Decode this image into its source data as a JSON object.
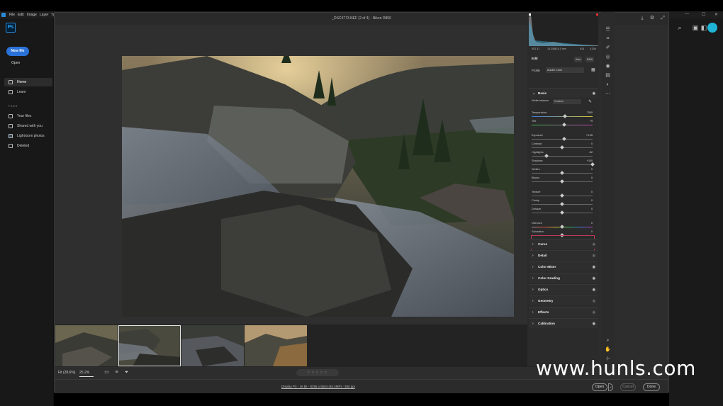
{
  "ps_menubar": {
    "items": [
      "File",
      "Edit",
      "Image",
      "Layer",
      "Ty"
    ]
  },
  "ps_home": {
    "logo": "Ps",
    "new_file": "New file",
    "open": "Open",
    "nav": [
      "Home",
      "Learn"
    ],
    "files_header": "FILES",
    "files": [
      "Your files",
      "Shared with you",
      "Lightroom photos",
      "Deleted"
    ]
  },
  "acr": {
    "title": "_DSC4773.NEF (2 of 4)  -  Nikon D850",
    "meta": {
      "iso": "ISO 31",
      "lens": "15-35@15.0 mm",
      "fstop": "f/16",
      "shutter": "0.20s"
    },
    "edit": {
      "label": "Edit",
      "auto": "Auto",
      "bw": "B&W"
    },
    "profile": {
      "label": "Profile",
      "value": "Adobe Color"
    },
    "basic": {
      "label": "Basic",
      "white_balance_label": "White balance",
      "white_balance_value": "Custom",
      "sliders": [
        {
          "label": "Temperature",
          "value": "7000",
          "pos": 0.55
        },
        {
          "label": "Tint",
          "value": "+9",
          "pos": 0.53
        },
        {
          "label": "Exposure",
          "value": "+0.35",
          "pos": 0.54
        },
        {
          "label": "Contrast",
          "value": "0",
          "pos": 0.5
        },
        {
          "label": "Highlights",
          "value": "-52",
          "pos": 0.24
        },
        {
          "label": "Shadows",
          "value": "+100",
          "pos": 1.0
        },
        {
          "label": "Whites",
          "value": "0",
          "pos": 0.5
        },
        {
          "label": "Blacks",
          "value": "0",
          "pos": 0.5
        },
        {
          "label": "Texture",
          "value": "0",
          "pos": 0.5
        },
        {
          "label": "Clarity",
          "value": "0",
          "pos": 0.5
        },
        {
          "label": "Dehaze",
          "value": "0",
          "pos": 0.5
        },
        {
          "label": "Vibrance",
          "value": "0",
          "pos": 0.5
        },
        {
          "label": "Saturation",
          "value": "0",
          "pos": 0.5
        }
      ]
    },
    "sections": [
      {
        "label": "Curve",
        "eye_active": false
      },
      {
        "label": "Detail",
        "eye_active": false
      },
      {
        "label": "Color Mixer",
        "eye_active": true
      },
      {
        "label": "Color Grading",
        "eye_active": true
      },
      {
        "label": "Optics",
        "eye_active": true
      },
      {
        "label": "Geometry",
        "eye_active": false
      },
      {
        "label": "Effects",
        "eye_active": false
      },
      {
        "label": "Calibration",
        "eye_active": true
      }
    ],
    "zoom": {
      "fit": "Fit (28.6%)",
      "pct": "25.2%"
    },
    "workflow": "Display P3 - 16 bit - 8256 x 5504 (45.4MP) - 300 ppi",
    "buttons": {
      "open": "Open",
      "cancel": "Cancel",
      "done": "Done"
    }
  },
  "watermark": "www.hunls.com",
  "colors": {
    "accent": "#2a72d8",
    "avatar": "#1fb5d6",
    "panel": "#2b2b2b"
  }
}
